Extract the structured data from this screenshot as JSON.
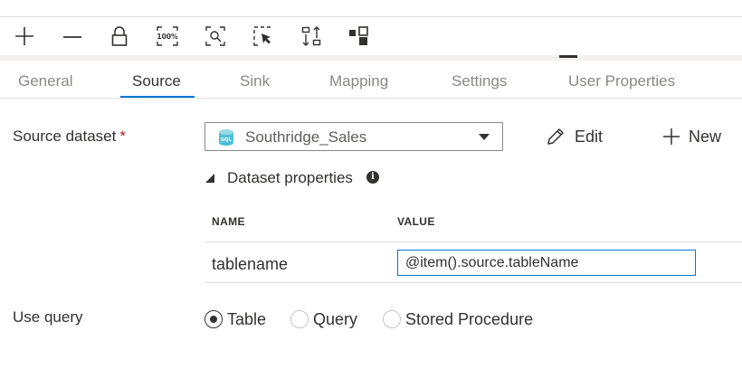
{
  "toolbar": {
    "tools": [
      "add-icon",
      "remove-icon",
      "lock-icon",
      "zoom-100-icon",
      "zoom-to-fit-icon",
      "select-icon",
      "auto-align-icon",
      "layout-icon"
    ],
    "zoom_label": "100%"
  },
  "tabs": [
    {
      "label": "General",
      "active": false
    },
    {
      "label": "Source",
      "active": true
    },
    {
      "label": "Sink",
      "active": false
    },
    {
      "label": "Mapping",
      "active": false
    },
    {
      "label": "Settings",
      "active": false
    },
    {
      "label": "User Properties",
      "active": false
    }
  ],
  "source": {
    "dataset_label": "Source dataset",
    "required_mark": "*",
    "dataset_value": "Southridge_Sales",
    "dataset_icon": "sql-database-icon",
    "db_badge": "SQL",
    "edit_label": "Edit",
    "new_label": "New"
  },
  "dataset_properties": {
    "title": "Dataset properties",
    "info_glyph": "i",
    "expanded": true,
    "columns": {
      "name": "NAME",
      "value": "VALUE"
    },
    "rows": [
      {
        "name": "tablename",
        "value": "@item().source.tableName"
      }
    ]
  },
  "use_query": {
    "label": "Use query",
    "options": [
      "Table",
      "Query",
      "Stored Procedure"
    ],
    "selected": "Table"
  },
  "colors": {
    "accent": "#0078d4",
    "text": "#323130",
    "muted": "#8a8886",
    "required": "#a4262c",
    "db_icon": "#50c0d8"
  }
}
